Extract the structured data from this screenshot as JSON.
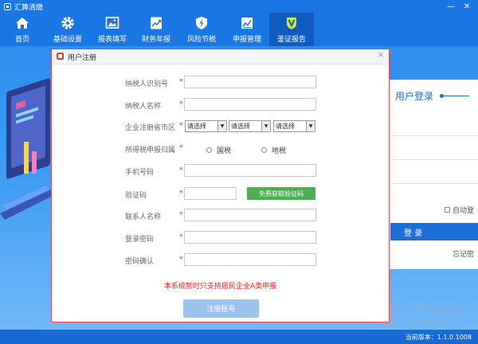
{
  "window": {
    "title": "汇算清缴",
    "minimize": "—",
    "close": "✕"
  },
  "toolbar": {
    "items": [
      {
        "label": "首页",
        "icon": "home-icon"
      },
      {
        "label": "基础设置",
        "icon": "gear-icon"
      },
      {
        "label": "报表填写",
        "icon": "report-image-icon"
      },
      {
        "label": "财务年报",
        "icon": "finance-chart-icon"
      },
      {
        "label": "风险节税",
        "icon": "shield-lightning-icon"
      },
      {
        "label": "申报管理",
        "icon": "declare-chart-icon"
      },
      {
        "label": "鉴证报告",
        "icon": "verify-badge-icon"
      }
    ],
    "active_index": 6
  },
  "dialog": {
    "title": "用户注册",
    "close": "×",
    "required_mark": "*",
    "fields": {
      "tax_id_label": "纳税人识别号",
      "taxpayer_name_label": "纳税人名称",
      "province_label": "企业注册省市区",
      "tax_bureau_label": "所得税申报归属",
      "phone_label": "手机号码",
      "captcha_label": "验证码",
      "contact_label": "联系人名称",
      "password_label": "登录密码",
      "confirm_label": "密码确认"
    },
    "selects": [
      "请选择",
      "请选择",
      "请选择"
    ],
    "radios": [
      "国税",
      "地税"
    ],
    "sms_button": "免费获取验证码",
    "notice": "本系统暂时只支持居民企业A类申报",
    "submit": "注册账号"
  },
  "login": {
    "title": "用户登录",
    "auto_login": "自动登",
    "button": "登 录",
    "forgot": "忘记密"
  },
  "status": {
    "version": "当前版本：1.1.0.1008"
  },
  "watermark": {
    "text": "当下软件园",
    "url": "www.downxia.com"
  },
  "colors": {
    "titlebar": "#1976e4",
    "active_tab": "#0f5bbf",
    "dialog_border": "#e64b4b",
    "sms_button": "#4caf50",
    "submit_button": "#9cc3ec",
    "required": "#ee2222"
  }
}
